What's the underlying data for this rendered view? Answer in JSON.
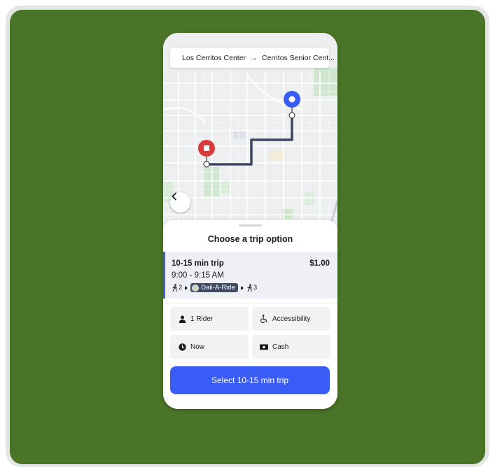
{
  "route": {
    "origin": "Los Cerritos Center",
    "arrow": "→",
    "destination": "Cerritos Senior Cent..."
  },
  "map": {
    "origin_pin_color": "#d93a3a",
    "destination_pin_color": "#3a5cf6",
    "route_color": "#3d4560"
  },
  "sheet": {
    "title": "Choose a trip option"
  },
  "trip": {
    "title": "10-15 min trip",
    "price": "$1.00",
    "time": "9:00 - 9:15 AM",
    "walk_before": "2",
    "service": "Dail-A-Ride",
    "walk_after": "3"
  },
  "options": {
    "riders": "1 Rider",
    "accessibility": "Accessibility",
    "when": "Now",
    "payment": "Cash"
  },
  "cta": {
    "label": "Select 10-15 min trip",
    "color": "#3a5cf6"
  },
  "colors": {
    "background": "#4a7428",
    "selected_card_accent": "#3c5ccf"
  }
}
